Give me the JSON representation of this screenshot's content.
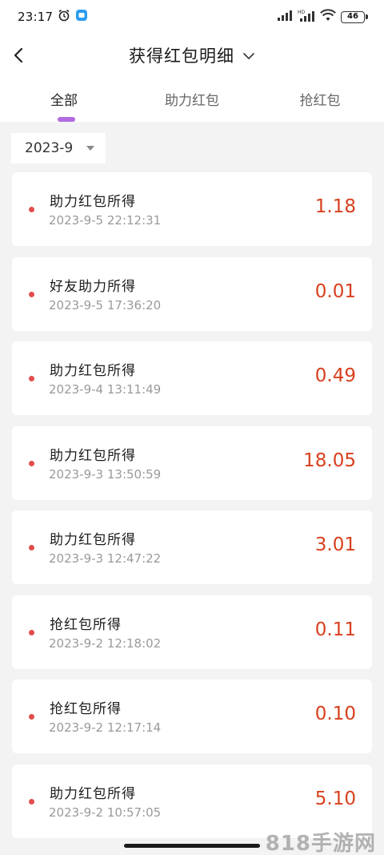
{
  "status_bar": {
    "time": "23:17",
    "battery": "46"
  },
  "header": {
    "title": "获得红包明细"
  },
  "tabs": [
    {
      "label": "全部",
      "active": true
    },
    {
      "label": "助力红包",
      "active": false
    },
    {
      "label": "抢红包",
      "active": false
    }
  ],
  "filter": {
    "month": "2023-9"
  },
  "records": [
    {
      "title": "助力红包所得",
      "time": "2023-9-5 22:12:31",
      "amount": "1.18"
    },
    {
      "title": "好友助力所得",
      "time": "2023-9-5 17:36:20",
      "amount": "0.01"
    },
    {
      "title": "助力红包所得",
      "time": "2023-9-4 13:11:49",
      "amount": "0.49"
    },
    {
      "title": "助力红包所得",
      "time": "2023-9-3 13:50:59",
      "amount": "18.05"
    },
    {
      "title": "助力红包所得",
      "time": "2023-9-3 12:47:22",
      "amount": "3.01"
    },
    {
      "title": "抢红包所得",
      "time": "2023-9-2 12:18:02",
      "amount": "0.11"
    },
    {
      "title": "抢红包所得",
      "time": "2023-9-2 12:17:14",
      "amount": "0.10"
    },
    {
      "title": "助力红包所得",
      "time": "2023-9-2 10:57:05",
      "amount": "5.10"
    }
  ],
  "watermark": "818手游网",
  "colors": {
    "accent": "#b06be0",
    "amount": "#d8401e",
    "dot": "#e24d4d"
  }
}
